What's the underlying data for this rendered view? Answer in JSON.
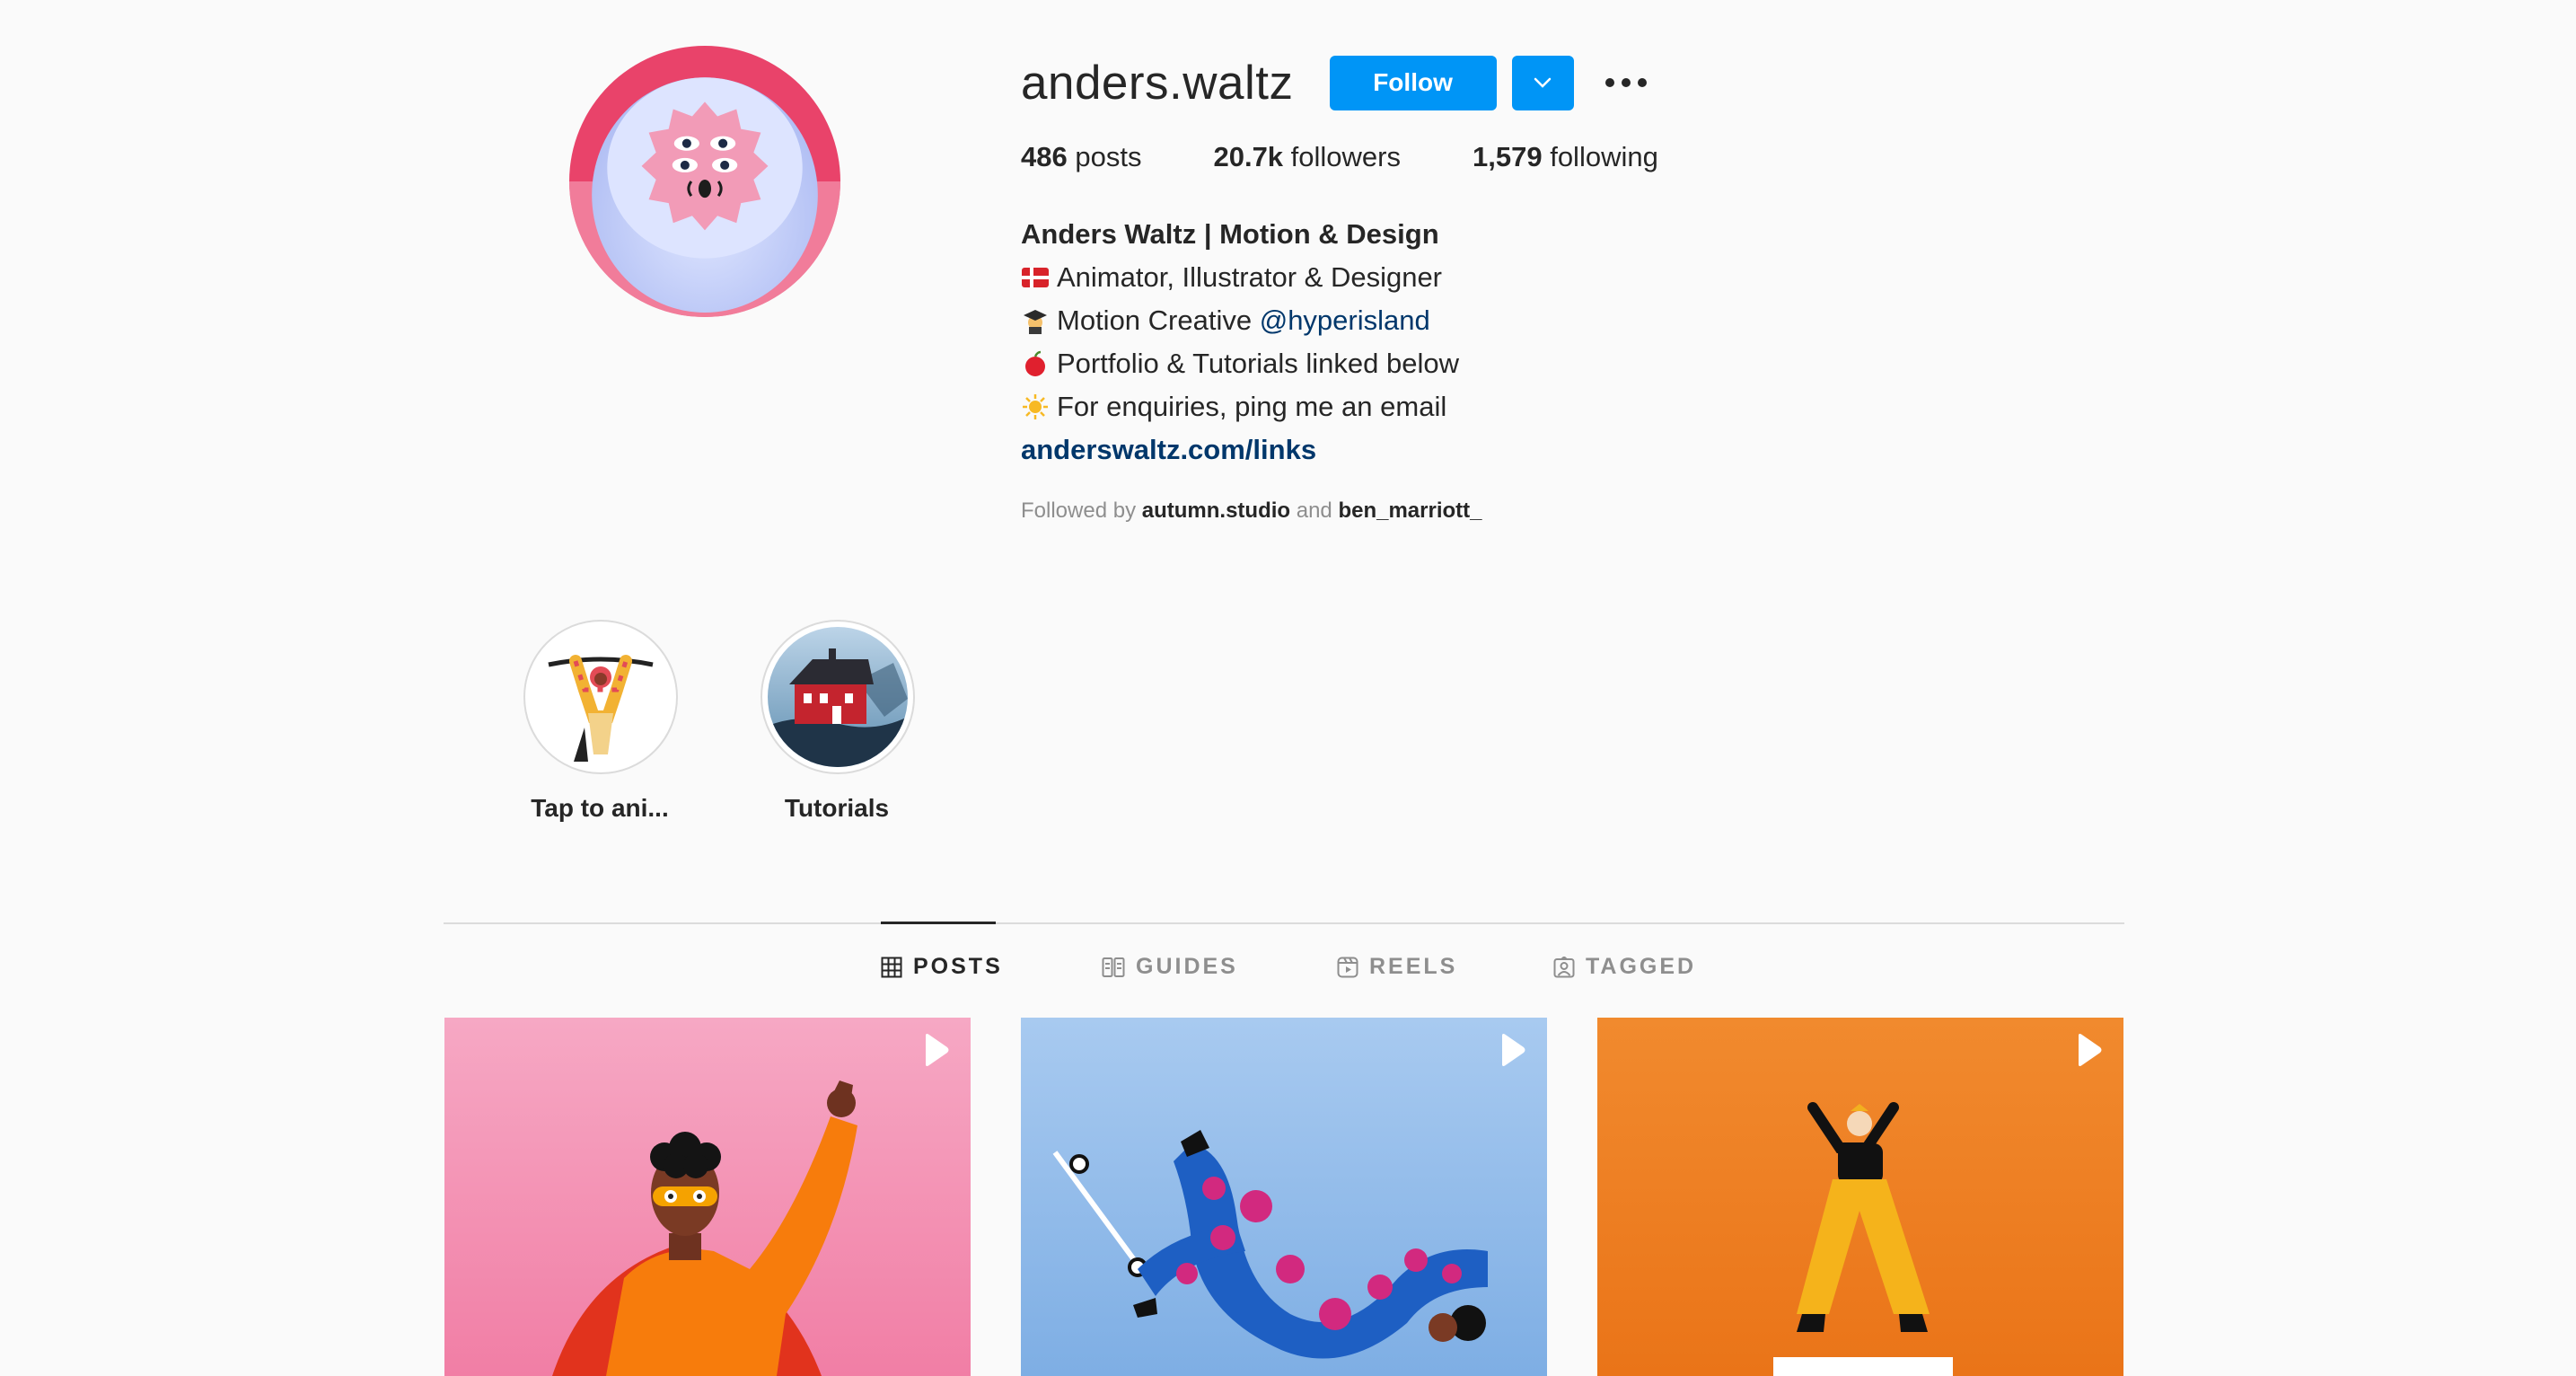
{
  "profile": {
    "username": "anders.waltz",
    "follow_label": "Follow",
    "stats": {
      "posts_count": "486",
      "posts_label": "posts",
      "followers_count": "20.7k",
      "followers_label": "followers",
      "following_count": "1,579",
      "following_label": "following"
    },
    "bio": {
      "full_name": "Anders Waltz | Motion & Design",
      "line1": "Animator, Illustrator & Designer",
      "line2_text": "Motion Creative ",
      "line2_mention": "@hyperisland",
      "line3": "Portfolio & Tutorials linked below",
      "line4": "For enquiries, ping me an email",
      "website": "anderswaltz.com/links"
    },
    "followed_by": {
      "prefix": "Followed by",
      "account1": "autumn.studio",
      "conjunction": "and",
      "account2": "ben_marriott_"
    }
  },
  "highlights": [
    {
      "label": "Tap to ani..."
    },
    {
      "label": "Tutorials"
    }
  ],
  "tabs": [
    {
      "label": "POSTS",
      "icon": "grid-icon",
      "active": true
    },
    {
      "label": "GUIDES",
      "icon": "guides-icon",
      "active": false
    },
    {
      "label": "REELS",
      "icon": "reels-icon",
      "active": false
    },
    {
      "label": "TAGGED",
      "icon": "tagged-icon",
      "active": false
    }
  ],
  "posts": [
    {
      "type": "video",
      "icon": "play-icon",
      "bg": "#f48fb1"
    },
    {
      "type": "video",
      "icon": "play-icon",
      "bg": "#a9c9ee"
    },
    {
      "type": "video",
      "icon": "play-icon",
      "bg": "#f08a2c"
    }
  ],
  "colors": {
    "accent": "#0095f6",
    "link": "#00376b",
    "text": "#262626",
    "secondary": "#8e8e8e",
    "background": "#fafafa"
  }
}
